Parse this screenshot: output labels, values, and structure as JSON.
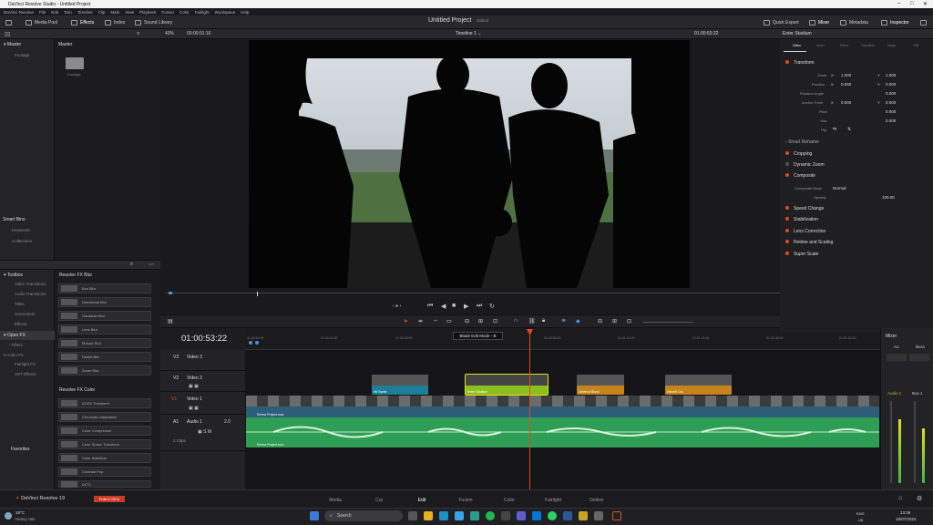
{
  "window": {
    "title": "DaVinci Resolve Studio - Untitled Project"
  },
  "menu": [
    "DaVinci Resolve",
    "File",
    "Edit",
    "Trim",
    "Timeline",
    "Clip",
    "Mark",
    "View",
    "Playback",
    "Fusion",
    "Color",
    "Fairlight",
    "Workspace",
    "Help"
  ],
  "toolbar": {
    "media_pool": "Media Pool",
    "effects": "Effects",
    "index": "Index",
    "sound_library": "Sound Library",
    "project_title": "Untitled Project",
    "edited": "Edited",
    "quick_export": "Quick Export",
    "mixer": "Mixer",
    "metadata": "Metadata",
    "inspector": "Inspector"
  },
  "media_pool": {
    "master": "Master",
    "footage": "Footage",
    "bin_header": "Master",
    "folder_label": "Footage",
    "smart_bins": "Smart Bins",
    "keywords": "Keywords",
    "collections": "Collections"
  },
  "effects_library": {
    "toolbox": "Toolbox",
    "items": [
      "Video Transitions",
      "Audio Transitions",
      "Titles",
      "Generators",
      "Effects"
    ],
    "open_fx": "Open FX",
    "open_fx_items": [
      "Filters"
    ],
    "audio_fx": "Audio FX",
    "audio_fx_items": [
      "Fairlight FX",
      "VST Effects"
    ],
    "favorites": "Favorites",
    "blur_header": "Resolve FX Blur",
    "blur_items": [
      "Box Blur",
      "Directional Blur",
      "Gaussian Blur",
      "Lens Blur",
      "Mosaic Blur",
      "Radial Blur",
      "Zoom Blur"
    ],
    "color_header": "Resolve FX Color",
    "color_items": [
      "ACES Transform",
      "Chromatic Adaptation",
      "Color Compressor",
      "Color Space Transform",
      "Color Stabilizer",
      "Contrast Pop",
      "DCTL"
    ]
  },
  "viewer": {
    "zoom": "43%",
    "source_tc": "00:00:01:16",
    "timeline_name": "Timeline 1",
    "record_tc": "01:00:53:22"
  },
  "timeline": {
    "timecode": "01:00:53:22",
    "ruler": [
      "01:00:00:00",
      "01:00:14:00",
      "01:00:28:00",
      "01:00:42:00",
      "01:00:56:00",
      "01:01:10:00",
      "01:01:24:00",
      "01:01:38:00",
      "01:01:52:00"
    ],
    "tooltip": "Blade Edit Mode - B",
    "tracks": [
      {
        "id": "V3",
        "name": "Video 3"
      },
      {
        "id": "V2",
        "name": "Video 2"
      },
      {
        "id": "V1",
        "name": "Video 1"
      },
      {
        "id": "A1",
        "name": "Audio 1",
        "volume": "2.0",
        "clips": "2 Clips"
      }
    ],
    "clips": [
      "Hit Sprint",
      "Enter Stadium",
      "Defence Block",
      "Helmet Cut"
    ],
    "v1_clip": "Emma Project.mov",
    "a1_clip": "Emma Project.mov"
  },
  "inspector": {
    "clip_name": "Enter Stadium",
    "tabs": [
      "Video",
      "Audio",
      "Effect",
      "Transition",
      "Image",
      "File"
    ],
    "transform": "Transform",
    "zoom_label": "Zoom",
    "zoom_x": "1.000",
    "zoom_y": "1.000",
    "position_label": "Position",
    "pos_x": "0.000",
    "pos_y": "0.000",
    "rotation_label": "Rotation Angle",
    "rotation": "0.000",
    "anchor_label": "Anchor Point",
    "anchor_x": "0.000",
    "anchor_y": "0.000",
    "pitch_label": "Pitch",
    "pitch": "0.000",
    "yaw_label": "Yaw",
    "yaw": "0.000",
    "flip_label": "Flip",
    "sections": [
      "Smart Reframe",
      "Cropping",
      "Dynamic Zoom",
      "Composite"
    ],
    "composite_mode_label": "Composite Mode",
    "composite_mode": "Normal",
    "opacity_label": "Opacity",
    "opacity": "100.00",
    "more_sections": [
      "Speed Change",
      "Stabilization",
      "Lens Correction",
      "Retime and Scaling",
      "Super Scale"
    ]
  },
  "mixer": {
    "title": "Mixer",
    "a1": "A1",
    "bus1": "Bus1",
    "audio1": "Audio 1",
    "bus1b": "Bus 1"
  },
  "audio_monitor": {
    "dim": "DIM"
  },
  "pages": [
    "Media",
    "Cut",
    "Edit",
    "Fusion",
    "Color",
    "Fairlight",
    "Deliver"
  ],
  "app": {
    "name": "DaVinci Resolve 19",
    "badge": "PUBLIC BETA"
  },
  "taskbar": {
    "temp": "19°C",
    "weather": "Heavy rain",
    "search": "Search",
    "lang1": "ENG",
    "lang2": "UK",
    "time": "13:36",
    "date": "15/07/2024"
  }
}
